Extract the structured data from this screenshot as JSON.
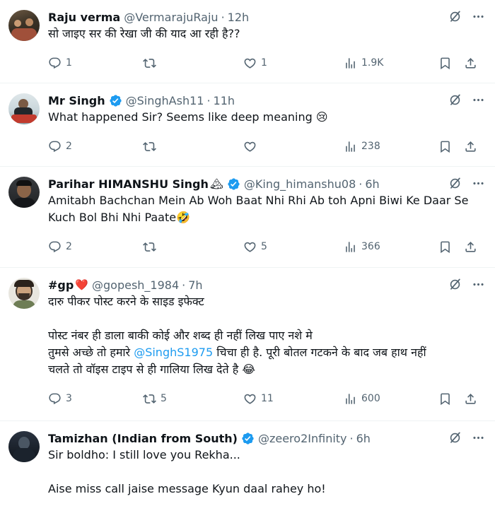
{
  "tweets": [
    {
      "name": "Raju verma",
      "handle": "@VermarajuRaju",
      "time": "12h",
      "verified": false,
      "lines": [
        "सो जाइए सर की रेखा जी की याद आ रही है??"
      ],
      "replies": "1",
      "retweets": "",
      "likes": "1",
      "views": "1.9K"
    },
    {
      "name": "Mr Singh",
      "handle": "@SinghAsh11",
      "time": "11h",
      "verified": true,
      "lines": [
        "What happened Sir? Seems like deep meaning 😢"
      ],
      "replies": "2",
      "retweets": "",
      "likes": "",
      "views": "238"
    },
    {
      "name": "Parihar HIMANSHU Singh",
      "name_emoji": "🏔",
      "handle": "@King_himanshu08",
      "time": "6h",
      "verified": true,
      "lines": [
        "Amitabh Bachchan Mein Ab Woh Baat Nhi Rhi Ab toh Apni Biwi Ke Daar Se",
        "Kuch Bol Bhi Nhi Paate🤣"
      ],
      "replies": "2",
      "retweets": "",
      "likes": "5",
      "views": "366"
    },
    {
      "name": "#gp",
      "name_emoji": "❤️",
      "handle": "@gopesh_1984",
      "time": "7h",
      "verified": false,
      "line1": "दारु पीकर पोस्ट करने के साइड इफेक्ट",
      "line2": "पोस्ट नंबर ही डाला बाकी कोई और शब्द ही नहीं लिख पाए नशे मे",
      "line3_pre": "तुमसे अच्छे तो हमारे ",
      "line3_mention": "@SinghS1975",
      "line3_post": " चिचा ही है. पूरी बोतल गटकने के बाद जब हाथ नहीं",
      "line4": "चलते तो वॉइस टाइप से ही गालिया लिख देते है 😂",
      "replies": "3",
      "retweets": "5",
      "likes": "11",
      "views": "600"
    },
    {
      "name": "Tamizhan (Indian from South)",
      "handle": "@zeero2Infinity",
      "time": "6h",
      "verified": true,
      "line1": "Sir boldho: I still love you Rekha...",
      "line2": "Aise miss call jaise message Kyun daal rahey ho!"
    }
  ],
  "separator": "·",
  "colors": {
    "verified": "#1d9bf0",
    "mention": "#1d9bf0",
    "muted": "#536471"
  },
  "icons": [
    "grok-icon",
    "more-icon",
    "reply-icon",
    "retweet-icon",
    "like-icon",
    "views-icon",
    "bookmark-icon",
    "share-icon",
    "verified-badge-icon"
  ]
}
